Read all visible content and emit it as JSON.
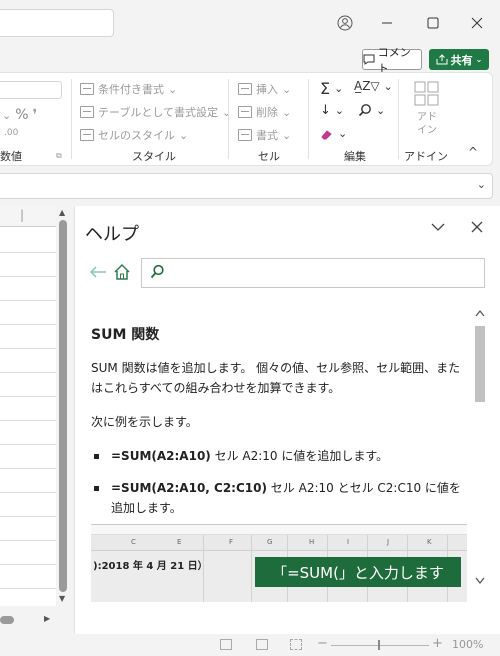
{
  "titlebar": {
    "profile_icon": "person-icon",
    "minimize_icon": "minimize-icon",
    "maximize_icon": "maximize-icon",
    "close_icon": "close-icon"
  },
  "actions": {
    "comment_label": "コメント",
    "share_label": "共有",
    "share_color": "#1f7a45"
  },
  "ribbon": {
    "number_group_label": "数値",
    "style": {
      "conditional_format": "条件付き書式",
      "format_as_table": "テーブルとして書式設定",
      "cell_styles": "セルのスタイル",
      "label": "スタイル"
    },
    "cells": {
      "insert": "挿入",
      "delete": "削除",
      "format": "書式",
      "label": "セル"
    },
    "editing": {
      "label": "編集"
    },
    "addins": {
      "addin_button": "アド\nイン",
      "label": "アドイン"
    }
  },
  "help": {
    "title": "ヘルプ",
    "heading": "SUM 関数",
    "intro": "SUM 関数は値を追加します。 個々の値、セル参照、セル範囲、またはこれらすべての組み合わせを加算できます。",
    "example_lead": "次に例を示します。",
    "bullets": [
      {
        "formula": "=SUM(A2:A10)",
        "desc": " セル A2:10 に値を追加します。"
      },
      {
        "formula": "=SUM(A2:A10, C2:C10)",
        "desc": " セル A2:10 とセル C2:C10 に値を追加します。"
      }
    ],
    "screenshot": {
      "columns": [
        "C",
        "E",
        "F",
        "G",
        "H",
        "I",
        "J",
        "K"
      ],
      "date_text": "):2018 年 4 月 21 日）",
      "banner_text": "「=SUM(」と入力します",
      "banner_color": "#1e6b3c"
    }
  },
  "status": {
    "zoom": "100%"
  }
}
